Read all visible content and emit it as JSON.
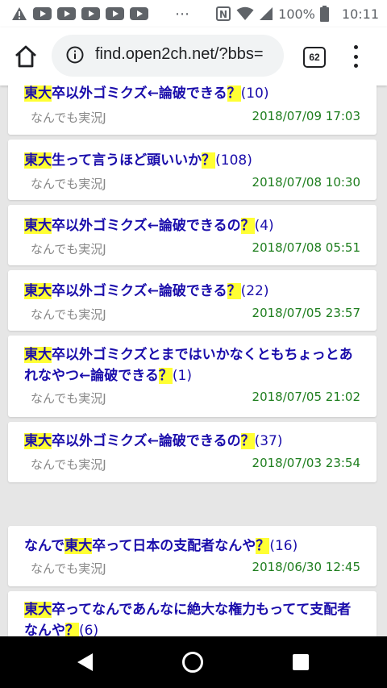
{
  "status_bar": {
    "battery_percent": "100%",
    "time": "10:11",
    "overflow": "⋯",
    "nfc_label": "N"
  },
  "browser": {
    "url": "find.open2ch.net/?bbs=",
    "tab_count": "62"
  },
  "threads": [
    {
      "pre": "",
      "hl1": "東大",
      "post": "卒以外ゴミクズ←論破できる",
      "q": "？",
      "count": "(10)",
      "board": "なんでも実況J",
      "date": "2018/07/09 17:03"
    },
    {
      "pre": "",
      "hl1": "東大",
      "post": "生って言うほど頭いいか",
      "q": "？",
      "count": "(108)",
      "board": "なんでも実況J",
      "date": "2018/07/08 10:30"
    },
    {
      "pre": "",
      "hl1": "東大",
      "post": "卒以外ゴミクズ←論破できるの",
      "q": "？",
      "count": "(4)",
      "board": "なんでも実況J",
      "date": "2018/07/08 05:51"
    },
    {
      "pre": "",
      "hl1": "東大",
      "post": "卒以外ゴミクズ←論破できる",
      "q": "？",
      "count": "(22)",
      "board": "なんでも実況J",
      "date": "2018/07/05 23:57"
    },
    {
      "pre": "",
      "hl1": "東大",
      "post": "卒以外ゴミクズとまではいかなくともちょっとあれなやつ←論破できる",
      "q": "？",
      "count": "(1)",
      "board": "なんでも実況J",
      "date": "2018/07/05 21:02"
    },
    {
      "pre": "",
      "hl1": "東大",
      "post": "卒以外ゴミクズ←論破できるの",
      "q": "？",
      "count": "(37)",
      "board": "なんでも実況J",
      "date": "2018/07/03 23:54"
    },
    {
      "pre": "なんで",
      "hl1": "東大",
      "post": "卒って日本の支配者なんや",
      "q": "？",
      "count": "(16)",
      "board": "なんでも実況J",
      "date": "2018/06/30 12:45"
    },
    {
      "pre": "",
      "hl1": "東大",
      "post": "卒ってなんであんなに絶大な権力もってて支配者なんや",
      "q": "？",
      "count": "(6)",
      "board": "",
      "date": ""
    }
  ],
  "colors": {
    "link": "#1a0dab",
    "highlight": "#ffff33",
    "date": "#1e7e1e",
    "board": "#888888",
    "background": "#e6e6e6"
  },
  "icons": [
    "alert-icon",
    "youtube-icon",
    "nfc-icon",
    "wifi-icon",
    "signal-icon",
    "battery-icon",
    "home-icon",
    "info-icon",
    "tabs-icon",
    "menu-icon",
    "back-icon",
    "home-circle-icon",
    "recents-icon"
  ]
}
